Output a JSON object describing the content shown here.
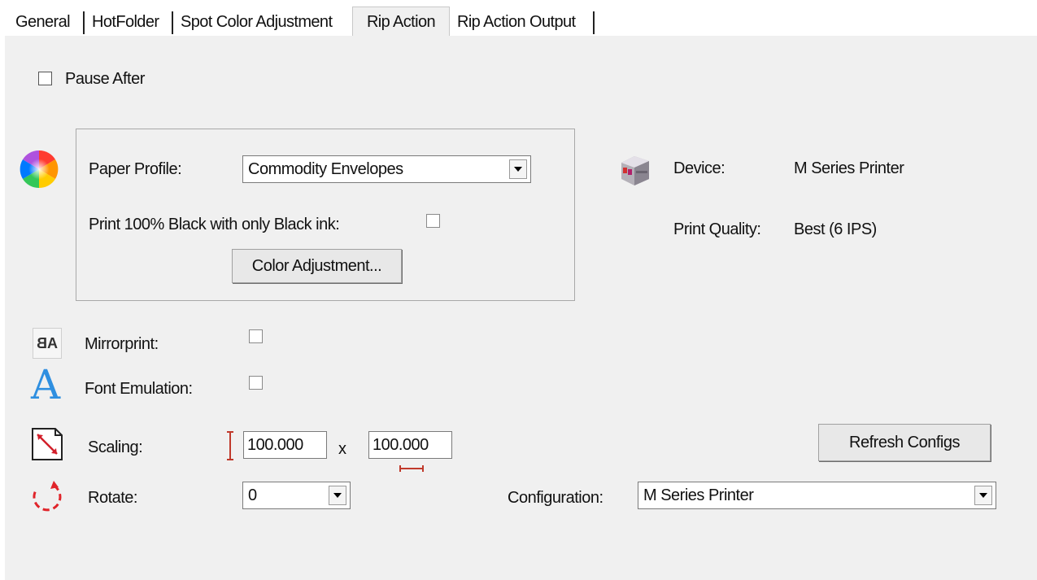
{
  "tabs": [
    {
      "label": "General"
    },
    {
      "label": "HotFolder"
    },
    {
      "label": "Spot Color Adjustment"
    },
    {
      "label": "Rip Action",
      "active": true
    },
    {
      "label": "Rip Action Output"
    }
  ],
  "pause_after": {
    "label": "Pause After",
    "checked": false
  },
  "color_group": {
    "paper_profile_label": "Paper Profile:",
    "paper_profile_value": "Commodity Envelopes",
    "black_ink_label": "Print 100% Black with only Black ink:",
    "black_ink_checked": false,
    "color_adjustment_button": "Color Adjustment..."
  },
  "device": {
    "device_label": "Device:",
    "device_value": "M Series Printer",
    "quality_label": "Print Quality:",
    "quality_value": "Best (6 IPS)"
  },
  "mirrorprint": {
    "label": "Mirrorprint:",
    "icon_text": "AB",
    "checked": false
  },
  "font_emulation": {
    "label": "Font Emulation:",
    "icon_text": "A",
    "checked": false
  },
  "scaling": {
    "label": "Scaling:",
    "height_value": "100.000",
    "separator": "x",
    "width_value": "100.000"
  },
  "rotate": {
    "label": "Rotate:",
    "value": "0"
  },
  "configuration": {
    "label": "Configuration:",
    "value": "M Series Printer"
  },
  "refresh_configs_button": "Refresh Configs",
  "colors": {
    "panel_bg": "#f0f0f0",
    "scaling_arrow": "#c0392b",
    "font_icon": "#2f8fe0",
    "rotate_icon": "#e0242a"
  }
}
